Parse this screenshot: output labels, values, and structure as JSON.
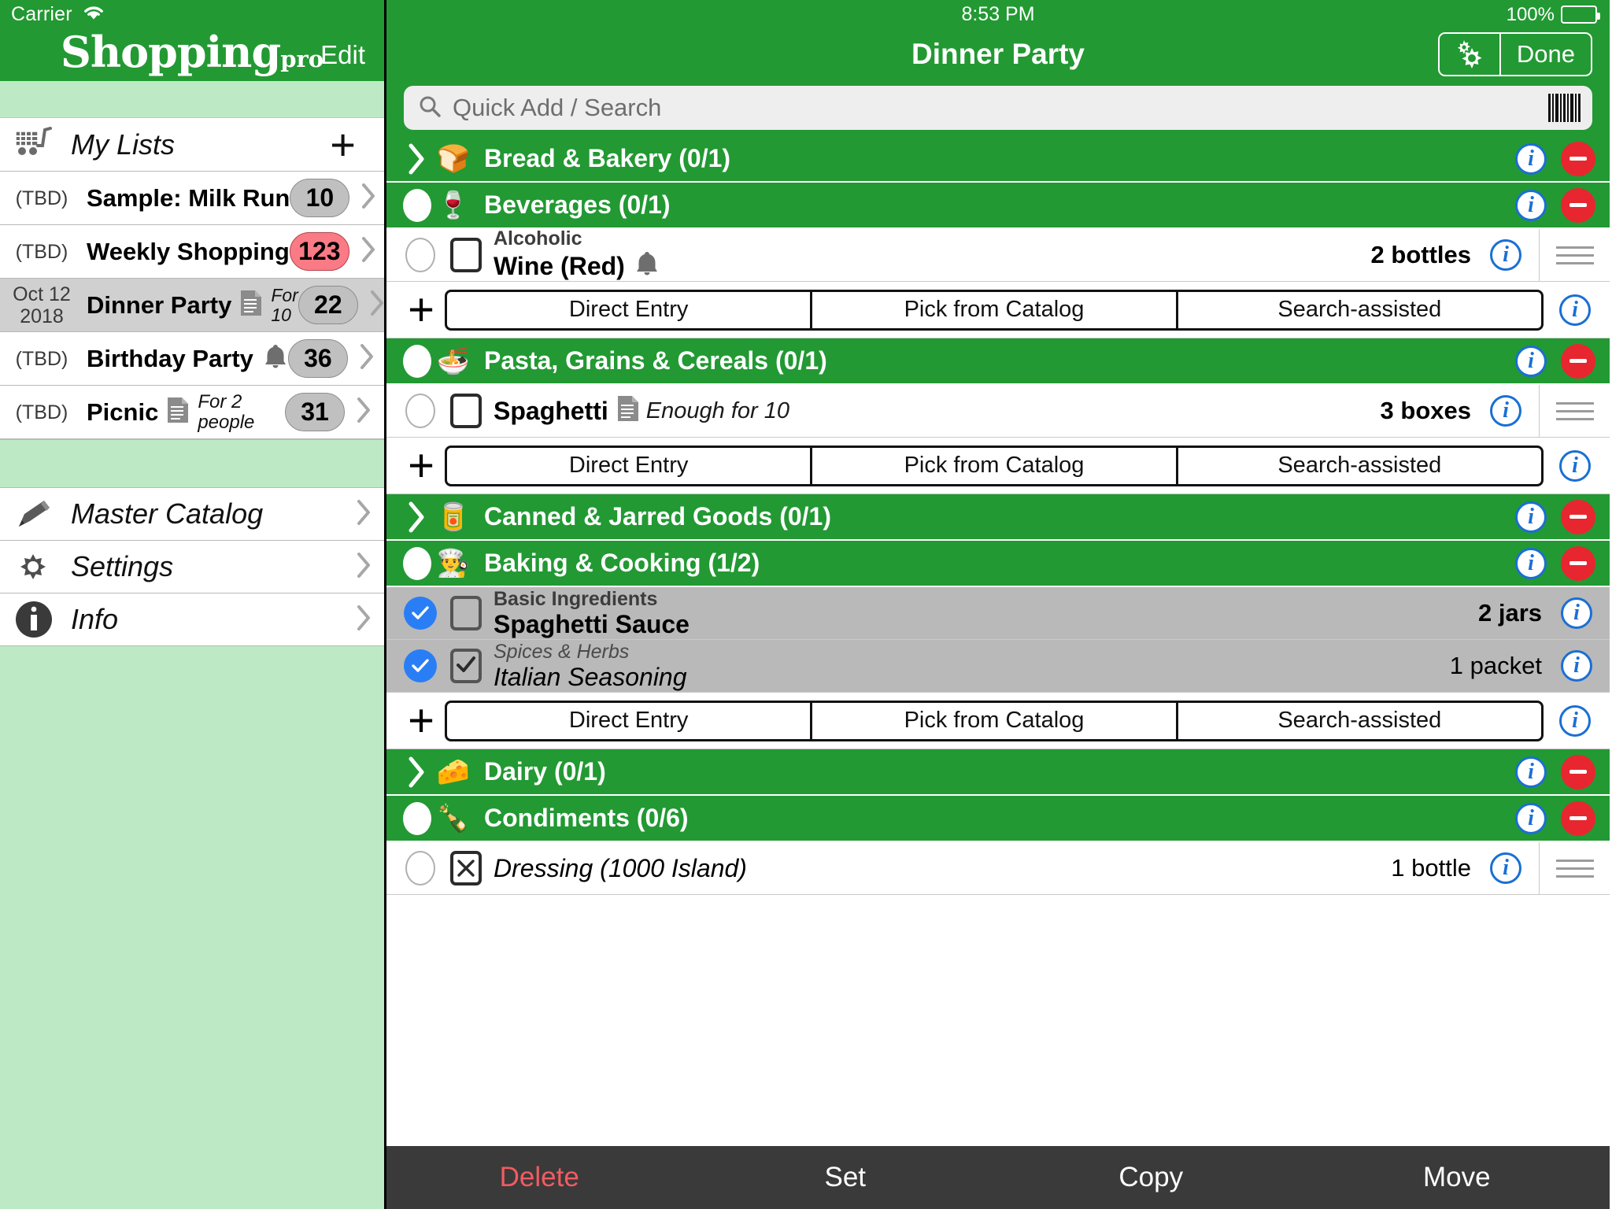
{
  "sidebar": {
    "status": {
      "carrier": "Carrier",
      "wifi_icon": "wifi-icon"
    },
    "nav": {
      "brand": "Shopping",
      "brand_suffix": "pro",
      "edit_label": "Edit"
    },
    "my_lists": {
      "label": "My Lists",
      "cart_icon": "shopping-cart-icon",
      "add_icon": "plus-icon"
    },
    "lists": [
      {
        "date": "(TBD)",
        "name": "Sample: Milk Run",
        "note_icon": "",
        "sub": "",
        "badge": "10",
        "badge_style": "grey"
      },
      {
        "date": "(TBD)",
        "name": "Weekly Shopping",
        "note_icon": "",
        "sub": "",
        "badge": "123",
        "badge_style": "red"
      },
      {
        "date": "Oct 12\n2018",
        "name": "Dinner Party",
        "note_icon": "document-icon",
        "sub": "For\n10",
        "badge": "22",
        "badge_style": "grey",
        "selected": true
      },
      {
        "date": "(TBD)",
        "name": "Birthday Party",
        "note_icon": "bell-icon",
        "sub": "",
        "badge": "36",
        "badge_style": "grey"
      },
      {
        "date": "(TBD)",
        "name": "Picnic",
        "note_icon": "document-icon",
        "sub": "For 2 people",
        "badge": "31",
        "badge_style": "grey"
      }
    ],
    "menu": [
      {
        "icon": "pencil-icon",
        "label": "Master Catalog"
      },
      {
        "icon": "gear-icon",
        "label": "Settings"
      },
      {
        "icon": "info-icon",
        "label": "Info"
      }
    ]
  },
  "main": {
    "status": {
      "time": "8:53 PM",
      "battery_pct": "100%",
      "battery_icon": "battery-icon"
    },
    "nav": {
      "title": "Dinner Party",
      "gear_icon": "gear-icon",
      "done_label": "Done"
    },
    "search": {
      "placeholder": "Quick Add / Search",
      "search_icon": "search-icon",
      "barcode_icon": "barcode-icon"
    },
    "add_row": {
      "plus_icon": "plus-icon",
      "direct_entry": "Direct Entry",
      "pick_from_catalog": "Pick from Catalog",
      "search_assisted": "Search-assisted",
      "info_icon": "info-circle-icon"
    },
    "sections": [
      {
        "id": "bread",
        "title": "Bread & Bakery (0/1)",
        "emoji": "🍞",
        "emoji_name": "bread-icon",
        "collapsed": true,
        "items": [],
        "show_add_row": false
      },
      {
        "id": "beverages",
        "title": "Beverages (0/1)",
        "emoji": "🍷",
        "emoji_name": "beverages-icon",
        "collapsed": false,
        "items": [
          {
            "checked": false,
            "box": "empty",
            "category": "Alcoholic",
            "name": "Wine (Red)",
            "trailing_icon": "bell-icon",
            "note": "",
            "qty": "2 bottles",
            "italic": false
          }
        ],
        "show_add_row": true
      },
      {
        "id": "pasta",
        "title": "Pasta, Grains & Cereals (0/1)",
        "emoji": "🍜",
        "emoji_name": "pasta-icon",
        "collapsed": false,
        "items": [
          {
            "checked": false,
            "box": "empty",
            "category": "",
            "name": "Spaghetti",
            "trailing_icon": "document-icon",
            "note": "Enough for 10",
            "qty": "3 boxes",
            "italic": false
          }
        ],
        "show_add_row": true
      },
      {
        "id": "canned",
        "title": "Canned & Jarred Goods (0/1)",
        "emoji": "🥫",
        "emoji_name": "canned-goods-icon",
        "collapsed": true,
        "items": [],
        "show_add_row": false
      },
      {
        "id": "baking",
        "title": "Baking & Cooking (1/2)",
        "emoji": "👨‍🍳",
        "emoji_name": "chef-hat-icon",
        "collapsed": false,
        "items": [
          {
            "checked": true,
            "box": "grey",
            "category": "Basic Ingredients",
            "name": "Spaghetti Sauce",
            "trailing_icon": "",
            "note": "",
            "qty": "2 jars",
            "italic": false,
            "selected": true
          },
          {
            "checked": true,
            "box": "checked",
            "category": "Spices & Herbs",
            "name": "Italian Seasoning",
            "trailing_icon": "",
            "note": "",
            "qty": "1 packet",
            "italic": true,
            "selected": true
          }
        ],
        "show_add_row": true
      },
      {
        "id": "dairy",
        "title": "Dairy (0/1)",
        "emoji": "🧀",
        "emoji_name": "cheese-icon",
        "collapsed": true,
        "items": [],
        "show_add_row": false
      },
      {
        "id": "condiments",
        "title": "Condiments (0/6)",
        "emoji": "🍾",
        "emoji_name": "bottle-icon",
        "collapsed": false,
        "items": [
          {
            "checked": false,
            "box": "x",
            "category": "",
            "name": "Dressing (1000 Island)",
            "trailing_icon": "",
            "note": "",
            "qty": "1 bottle",
            "italic": true
          }
        ],
        "show_add_row": false
      }
    ],
    "toolbar": {
      "delete": "Delete",
      "set": "Set",
      "copy": "Copy",
      "move": "Move"
    }
  }
}
